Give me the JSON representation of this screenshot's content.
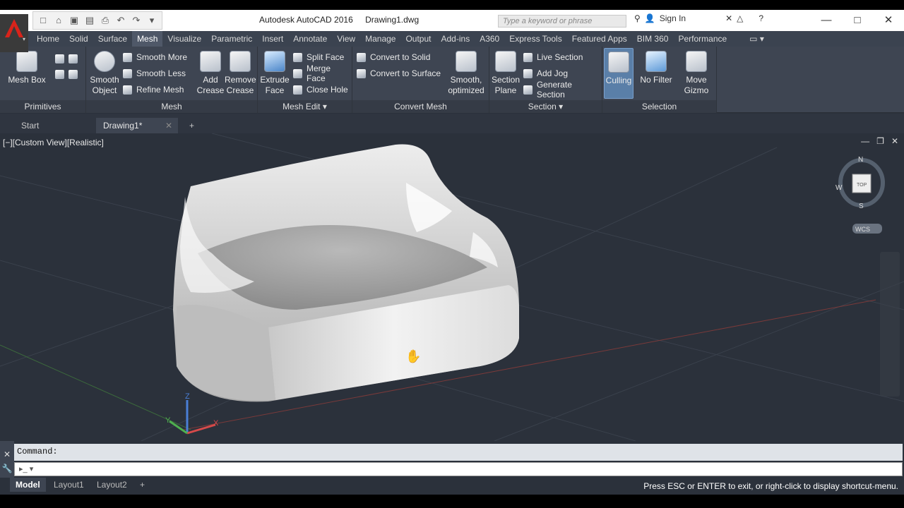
{
  "app": {
    "title": "Autodesk AutoCAD 2016",
    "document": "Drawing1.dwg",
    "logo_letter": "A"
  },
  "qat": {
    "icons": [
      "new-icon",
      "open-icon",
      "save-icon",
      "saveas-icon",
      "print-icon",
      "undo-icon",
      "redo-icon",
      "dropdown-icon"
    ]
  },
  "search": {
    "placeholder": "Type a keyword or phrase"
  },
  "signin": {
    "label": "Sign In"
  },
  "tabs": [
    "Home",
    "Solid",
    "Surface",
    "Mesh",
    "Visualize",
    "Parametric",
    "Insert",
    "Annotate",
    "View",
    "Manage",
    "Output",
    "Add-ins",
    "A360",
    "Express Tools",
    "Featured Apps",
    "BIM 360",
    "Performance"
  ],
  "active_tab": "Mesh",
  "ribbon": {
    "primitives": {
      "label": "Primitives",
      "mesh_box": "Mesh Box"
    },
    "mesh": {
      "label": "Mesh",
      "smooth_object": "Smooth Object",
      "smooth_more": "Smooth More",
      "smooth_less": "Smooth Less",
      "refine_mesh": "Refine Mesh",
      "add_crease": "Add Crease",
      "remove_crease": "Remove Crease"
    },
    "mesh_edit": {
      "label": "Mesh Edit",
      "extrude_face": "Extrude Face",
      "split_face": "Split Face",
      "merge_face": "Merge Face",
      "close_hole": "Close Hole"
    },
    "convert_mesh": {
      "label": "Convert Mesh",
      "convert_to_solid": "Convert to Solid",
      "convert_to_surface": "Convert to Surface",
      "smooth_optimized": "Smooth, optimized"
    },
    "section": {
      "label": "Section",
      "section_plane": "Section Plane",
      "live_section": "Live Section",
      "add_jog": "Add Jog",
      "generate_section": "Generate Section"
    },
    "selection": {
      "label": "Selection",
      "culling": "Culling",
      "no_filter": "No Filter",
      "move_gizmo": "Move Gizmo"
    }
  },
  "doctabs": {
    "start": "Start",
    "drawing": "Drawing1*"
  },
  "viewport": {
    "label": "[−][Custom View][Realistic]",
    "viewcube": {
      "n": "N",
      "s": "S",
      "w": "W",
      "top": "TOP",
      "wcs": "WCS"
    }
  },
  "command": {
    "prompt": "Command:"
  },
  "layouts": [
    "Model",
    "Layout1",
    "Layout2"
  ],
  "active_layout": "Model",
  "status": {
    "message": "Press ESC or ENTER to exit, or right-click to display shortcut-menu."
  }
}
